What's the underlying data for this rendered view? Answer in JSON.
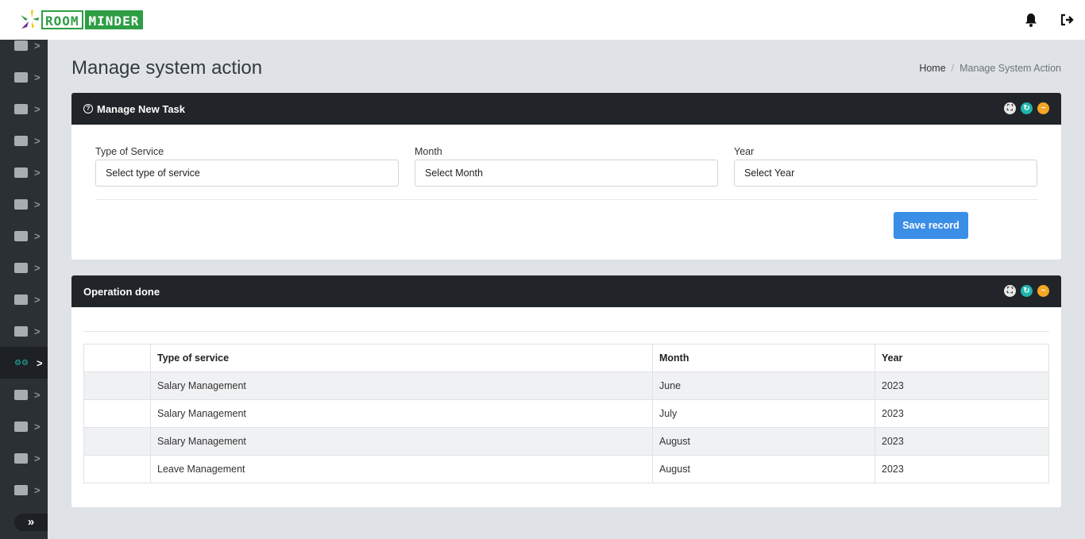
{
  "app": {
    "logo_left": "ROOM",
    "logo_right": "MINDER"
  },
  "topbar": {
    "icons": [
      "bell-icon",
      "sign-out-icon"
    ]
  },
  "sidebar": {
    "items": [
      "bed-icon",
      "money-icon",
      "hamburger-icon",
      "flag-checkered-icon",
      "user-icon",
      "users-icon",
      "users-cog-icon",
      "medal-icon",
      "binoculars-icon",
      "warehouse-icon",
      "cogs-icon",
      "handshake-icon",
      "flag-checkered-icon",
      "images-icon",
      "id-badge-icon"
    ],
    "active_index": 10,
    "toggle": "»"
  },
  "page": {
    "title": "Manage system action",
    "breadcrumb": {
      "home": "Home",
      "current": "Manage System Action"
    }
  },
  "task_panel": {
    "title": "Manage New Task",
    "fields": [
      {
        "label": "Type of Service",
        "value": "Select type of service"
      },
      {
        "label": "Month",
        "value": "Select Month"
      },
      {
        "label": "Year",
        "value": "Select Year"
      }
    ],
    "save_label": "Save record"
  },
  "ops_panel": {
    "title": "Operation done",
    "columns": [
      "",
      "Type of service",
      "Month",
      "Year"
    ],
    "rows": [
      [
        "",
        "Salary Management",
        "June",
        "2023"
      ],
      [
        "",
        "Salary Management",
        "July",
        "2023"
      ],
      [
        "",
        "Salary Management",
        "August",
        "2023"
      ],
      [
        "",
        "Leave Management",
        "August",
        "2023"
      ]
    ]
  },
  "colors": {
    "accent": "#1fb5ad",
    "primary": "#3a8ee6",
    "header": "#212529",
    "warning": "#f5a623"
  }
}
